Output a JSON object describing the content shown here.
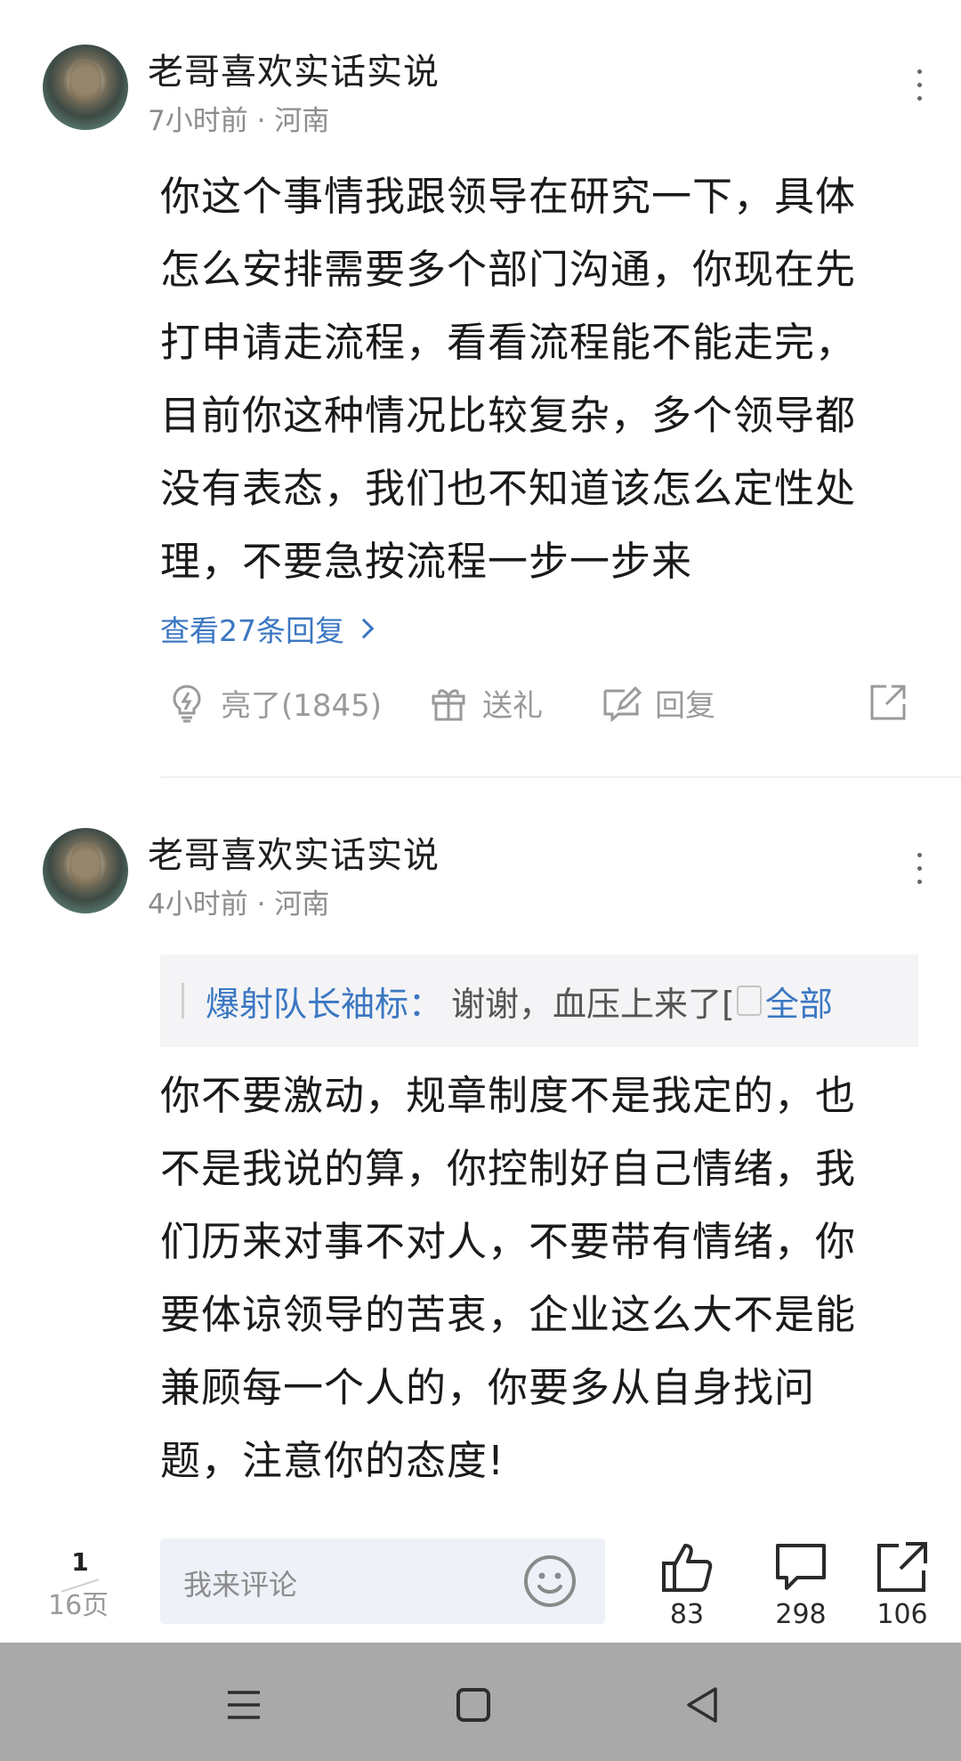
{
  "comments": [
    {
      "username": "老哥喜欢实话实说",
      "time": "7小时前",
      "location": "河南",
      "lines": [
        "你这个事情我跟领导在研究一下，具体",
        "怎么安排需要多个部门沟通，你现在先",
        "打申请走流程，看看流程能不能走完，",
        "目前你这种情况比较复杂，多个领导都",
        "没有表态，我们也不知道该怎么定性处",
        "理，不要急按流程一步一步来"
      ],
      "view_replies": "查看27条回复",
      "actions": {
        "like": "亮了(1845)",
        "gift": "送礼",
        "reply": "回复"
      }
    },
    {
      "username": "老哥喜欢实话实说",
      "time": "4小时前",
      "location": "河南",
      "quote": {
        "user": "爆射队长袖标：",
        "text": "谢谢，血压上来了[",
        "more": "全部"
      },
      "lines": [
        "你不要激动，规章制度不是我定的，也",
        "不是我说的算，你控制好自己情绪，我",
        "们历来对事不对人，不要带有情绪，你",
        "要体谅领导的苦衷，企业这么大不是能",
        "兼顾每一个人的，你要多从自身找问",
        "题，注意你的态度!"
      ]
    }
  ],
  "bottom_bar": {
    "page_current": "1",
    "page_total": "16页",
    "comment_placeholder": "我来评论",
    "likes": "83",
    "comments": "298",
    "shares": "106"
  },
  "colors": {
    "link": "#3b77c2",
    "meta": "#8c8c8c",
    "nav_bar": "#a9a9a9"
  }
}
